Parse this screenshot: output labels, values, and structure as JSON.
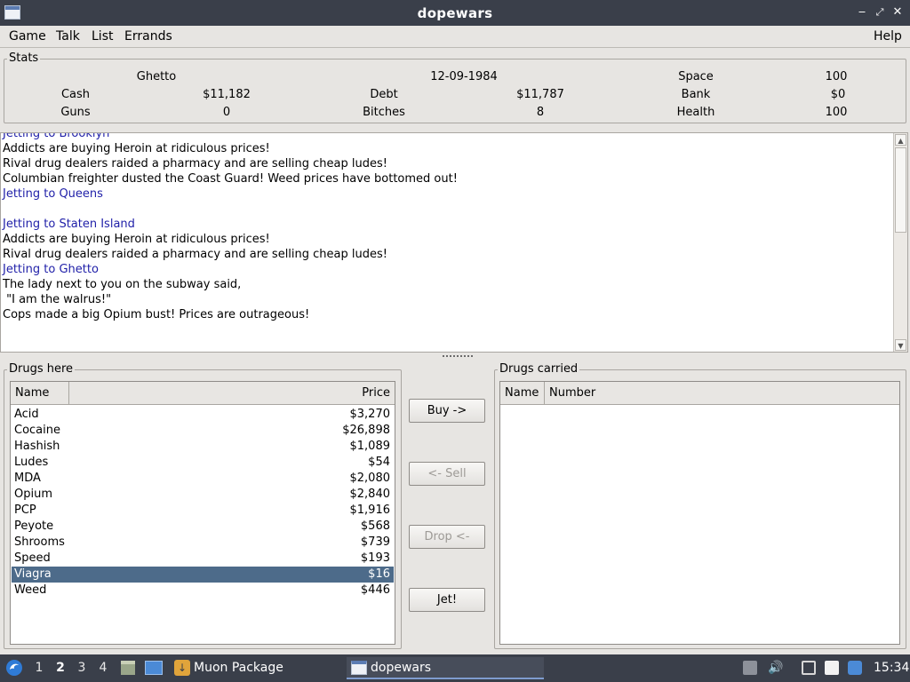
{
  "window": {
    "title": "dopewars"
  },
  "menu": {
    "game": "Game",
    "talk": "Talk",
    "list": "List",
    "errands": "Errands",
    "help": "Help"
  },
  "stats": {
    "legend": "Stats",
    "location": "Ghetto",
    "date": "12-09-1984",
    "space_label": "Space",
    "space_value": "100",
    "cash_label": "Cash",
    "cash_value": "$11,182",
    "debt_label": "Debt",
    "debt_value": "$11,787",
    "bank_label": "Bank",
    "bank_value": "$0",
    "guns_label": "Guns",
    "guns_value": "0",
    "bitches_label": "Bitches",
    "bitches_value": "8",
    "health_label": "Health",
    "health_value": "100"
  },
  "log": {
    "lines": [
      {
        "text": "Jetting to Brooklyn",
        "type": "travel"
      },
      {
        "text": "Addicts are buying Heroin at ridiculous prices!",
        "type": "event"
      },
      {
        "text": "Rival drug dealers raided a pharmacy and are selling cheap ludes!",
        "type": "event"
      },
      {
        "text": "Columbian freighter dusted the Coast Guard! Weed prices have bottomed out!",
        "type": "event"
      },
      {
        "text": "Jetting to Queens",
        "type": "travel"
      },
      {
        "text": "",
        "type": "event"
      },
      {
        "text": "Jetting to Staten Island",
        "type": "travel"
      },
      {
        "text": "Addicts are buying Heroin at ridiculous prices!",
        "type": "event"
      },
      {
        "text": "Rival drug dealers raided a pharmacy and are selling cheap ludes!",
        "type": "event"
      },
      {
        "text": "Jetting to Ghetto",
        "type": "travel"
      },
      {
        "text": "The lady next to you on the subway said,",
        "type": "event"
      },
      {
        "text": " \"I am the walrus!\"",
        "type": "event"
      },
      {
        "text": "Cops made a big Opium bust! Prices are outrageous!",
        "type": "event"
      }
    ]
  },
  "drugs_here": {
    "legend": "Drugs here",
    "col_name": "Name",
    "col_price": "Price",
    "rows": [
      {
        "name": "Acid",
        "price": "$3,270"
      },
      {
        "name": "Cocaine",
        "price": "$26,898"
      },
      {
        "name": "Hashish",
        "price": "$1,089"
      },
      {
        "name": "Ludes",
        "price": "$54"
      },
      {
        "name": "MDA",
        "price": "$2,080"
      },
      {
        "name": "Opium",
        "price": "$2,840"
      },
      {
        "name": "PCP",
        "price": "$1,916"
      },
      {
        "name": "Peyote",
        "price": "$568"
      },
      {
        "name": "Shrooms",
        "price": "$739"
      },
      {
        "name": "Speed",
        "price": "$193"
      },
      {
        "name": "Viagra",
        "price": "$16",
        "selected": true
      },
      {
        "name": "Weed",
        "price": "$446"
      }
    ]
  },
  "actions": {
    "buy": "Buy ->",
    "sell": "<- Sell",
    "drop": "Drop <-",
    "jet": "Jet!"
  },
  "drugs_carried": {
    "legend": "Drugs carried",
    "col_name": "Name",
    "col_number": "Number"
  },
  "taskbar": {
    "workspaces": [
      "1",
      "2",
      "3",
      "4"
    ],
    "active_workspace": "2",
    "tasks": [
      {
        "label": "Muon Package Manager"
      },
      {
        "label": "dopewars",
        "active": true
      }
    ],
    "clock": "15:34"
  },
  "colors": {
    "selection": "#4d6b8a",
    "travel_text": "#1f1fa8",
    "panel_bar": "#3a3f4a"
  }
}
